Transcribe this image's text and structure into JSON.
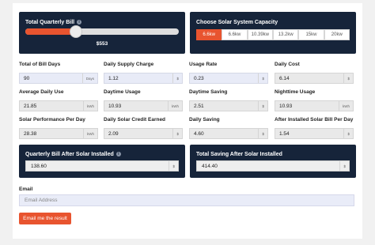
{
  "quarterly_bill": {
    "title": "Total Quarterly Bill",
    "info_icon": "info-icon",
    "value": "$553",
    "slider_level_percent": 33
  },
  "capacity": {
    "title": "Choose Solar System Capacity",
    "options": [
      "6.6kw",
      "6.6kw",
      "10.39kw",
      "13.2kw",
      "15kw",
      "20kw"
    ],
    "selected_index": 0
  },
  "fields": {
    "total_bill_days": {
      "label": "Total of Bill Days",
      "value": "90",
      "unit": "Days"
    },
    "daily_supply_charge": {
      "label": "Daily Supply Charge",
      "value": "1.12",
      "unit": "$"
    },
    "usage_rate": {
      "label": "Usage Rate",
      "value": "0.23",
      "unit": "$"
    },
    "daily_cost": {
      "label": "Daily Cost",
      "value": "6.14",
      "unit": "$"
    },
    "average_daily_use": {
      "label": "Average Daily Use",
      "value": "21.85",
      "unit": "kWh"
    },
    "daytime_usage": {
      "label": "Daytime Usage",
      "value": "10.93",
      "unit": "kWh"
    },
    "daytime_saving": {
      "label": "Daytime Saving",
      "value": "2.51",
      "unit": "$"
    },
    "nighttime_usage": {
      "label": "Nighttime Usage",
      "value": "10.93",
      "unit": "kWh"
    },
    "solar_performance": {
      "label": "Solar Performance Per Day",
      "value": "28.38",
      "unit": "kWh"
    },
    "daily_solar_credit": {
      "label": "Daily Solar Credit Earned",
      "value": "2.09",
      "unit": "$"
    },
    "daily_saving": {
      "label": "Daily Saving",
      "value": "4.60",
      "unit": "$"
    },
    "after_solar_bill": {
      "label": "After Installed Solar Bill Per Day",
      "value": "1.54",
      "unit": "$"
    }
  },
  "quarterly_after": {
    "title": "Quarterly Bill After Solar Installed",
    "value": "138.60",
    "unit": "$"
  },
  "total_saving": {
    "title": "Total Saving After Solar Installed",
    "value": "414.40",
    "unit": "$"
  },
  "email": {
    "label": "Email",
    "placeholder": "Email Address",
    "button": "Email me the result"
  },
  "colors": {
    "accent": "#e8542f",
    "panel": "#16243a"
  }
}
